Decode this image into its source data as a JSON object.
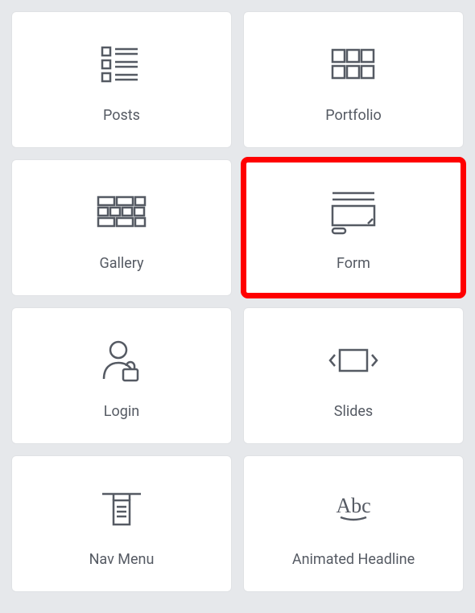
{
  "widgets": [
    {
      "id": "posts",
      "label": "Posts",
      "icon": "posts-icon",
      "highlight": false
    },
    {
      "id": "portfolio",
      "label": "Portfolio",
      "icon": "portfolio-icon",
      "highlight": false
    },
    {
      "id": "gallery",
      "label": "Gallery",
      "icon": "gallery-icon",
      "highlight": false
    },
    {
      "id": "form",
      "label": "Form",
      "icon": "form-icon",
      "highlight": true
    },
    {
      "id": "login",
      "label": "Login",
      "icon": "login-icon",
      "highlight": false
    },
    {
      "id": "slides",
      "label": "Slides",
      "icon": "slides-icon",
      "highlight": false
    },
    {
      "id": "nav-menu",
      "label": "Nav Menu",
      "icon": "nav-menu-icon",
      "highlight": false
    },
    {
      "id": "animated-headline",
      "label": "Animated Headline",
      "icon": "animated-headline-icon",
      "highlight": false
    }
  ],
  "colors": {
    "highlight": "#ff0000",
    "icon_stroke": "#555a63",
    "label": "#555a63",
    "bg": "#e6e8eb",
    "tile_bg": "#ffffff"
  }
}
